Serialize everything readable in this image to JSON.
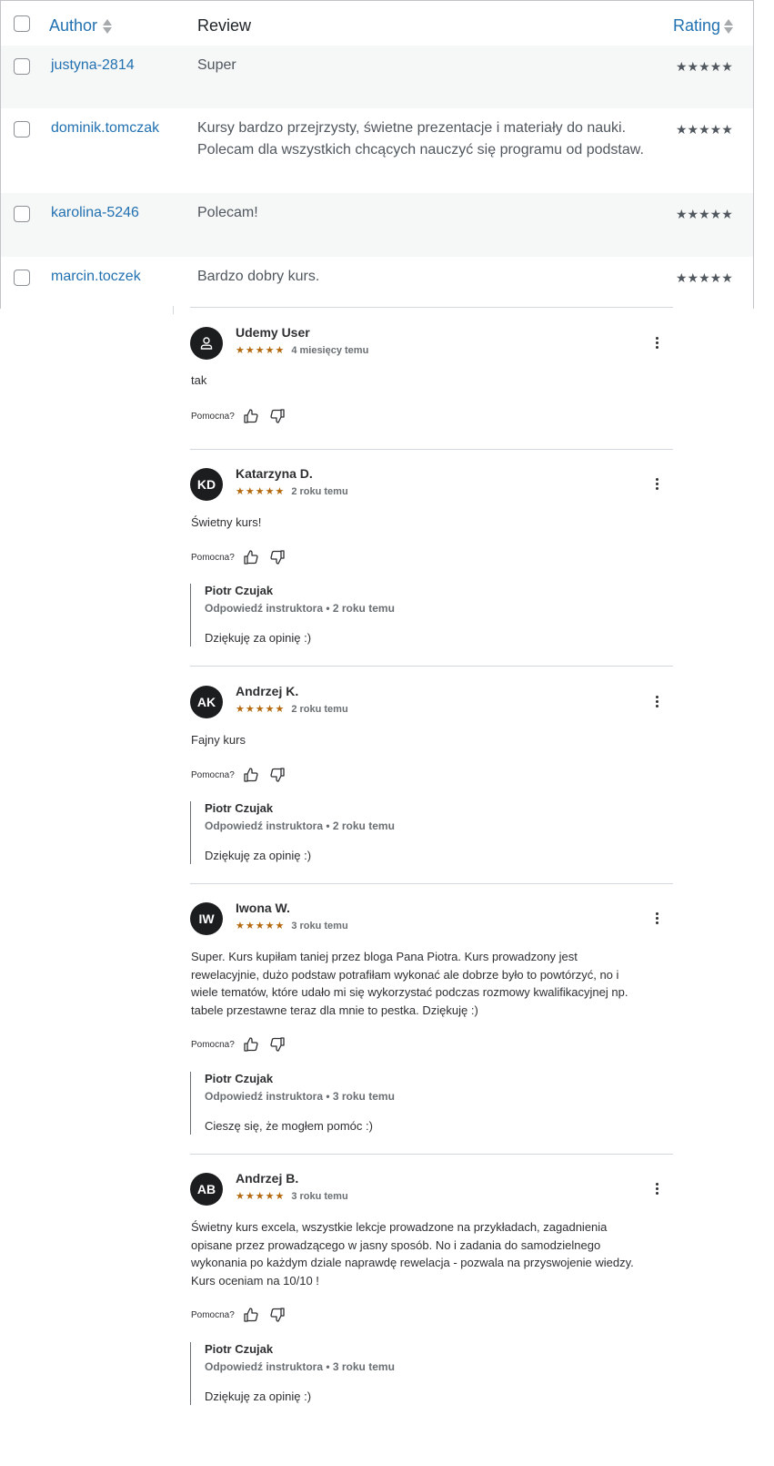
{
  "table": {
    "headers": {
      "author": "Author",
      "review": "Review",
      "rating": "Rating"
    },
    "rows": [
      {
        "author": "justyna-2814",
        "review_lines": [
          "Super"
        ],
        "rating": "★★★★★"
      },
      {
        "author": "dominik.tomczak",
        "review_lines": [
          "Kursy bardzo przejrzysty, świetne prezentacje i materiały do nauki.",
          "Polecam dla wszystkich chcących nauczyć się programu od podstaw."
        ],
        "rating": "★★★★★"
      },
      {
        "author": "karolina-5246",
        "review_lines": [
          "Polecam!"
        ],
        "rating": "★★★★★"
      },
      {
        "author": "marcin.toczek",
        "review_lines": [
          "Bardzo dobry kurs."
        ],
        "rating": "★★★★★"
      }
    ]
  },
  "reviews": [
    {
      "initials": "",
      "avatar_icon": "user-icon",
      "name": "Udemy User",
      "stars": "★★★★★",
      "time": "4 miesięcy temu",
      "body": "tak",
      "helpful_label": "Pomocna?"
    },
    {
      "initials": "KD",
      "name": "Katarzyna D.",
      "stars": "★★★★★",
      "time": "2 roku temu",
      "body": "Świetny kurs!",
      "helpful_label": "Pomocna?",
      "reply": {
        "name": "Piotr Czujak",
        "meta": "Odpowiedź instruktora • 2 roku temu",
        "text": "Dziękuję za opinię :)"
      }
    },
    {
      "initials": "AK",
      "name": "Andrzej K.",
      "stars": "★★★★★",
      "time": "2 roku temu",
      "body": "Fajny kurs",
      "helpful_label": "Pomocna?",
      "reply": {
        "name": "Piotr Czujak",
        "meta": "Odpowiedź instruktora • 2 roku temu",
        "text": "Dziękuję za opinię :)"
      }
    },
    {
      "initials": "IW",
      "name": "Iwona W.",
      "stars": "★★★★★",
      "time": "3 roku temu",
      "body_lines": [
        "Super. Kurs kupiłam taniej przez bloga Pana Piotra. Kurs prowadzony jest",
        "rewelacyjnie, dużo podstaw potrafiłam wykonać ale dobrze było to powtórzyć, no i",
        "wiele tematów, które udało mi się wykorzystać podczas rozmowy kwalifikacyjnej np.",
        "tabele przestawne teraz dla mnie to pestka. Dziękuję :)"
      ],
      "helpful_label": "Pomocna?",
      "reply": {
        "name": "Piotr Czujak",
        "meta": "Odpowiedź instruktora • 3 roku temu",
        "text": "Cieszę się, że mogłem pomóc :)"
      }
    },
    {
      "initials": "AB",
      "name": "Andrzej B.",
      "stars": "★★★★★",
      "time": "3 roku temu",
      "body_lines": [
        "Świetny kurs excela, wszystkie lekcje prowadzone na przykładach, zagadnienia",
        "opisane przez prowadzącego w jasny sposób. No i zadania do samodzielnego",
        "wykonania po każdym dziale naprawdę rewelacja - pozwala na przyswojenie wiedzy.",
        "Kurs oceniam na 10/10 !"
      ],
      "helpful_label": "Pomocna?",
      "reply": {
        "name": "Piotr Czujak",
        "meta": "Odpowiedź instruktora • 3 roku temu",
        "text": "Dziękuję za opinię :)"
      }
    }
  ]
}
